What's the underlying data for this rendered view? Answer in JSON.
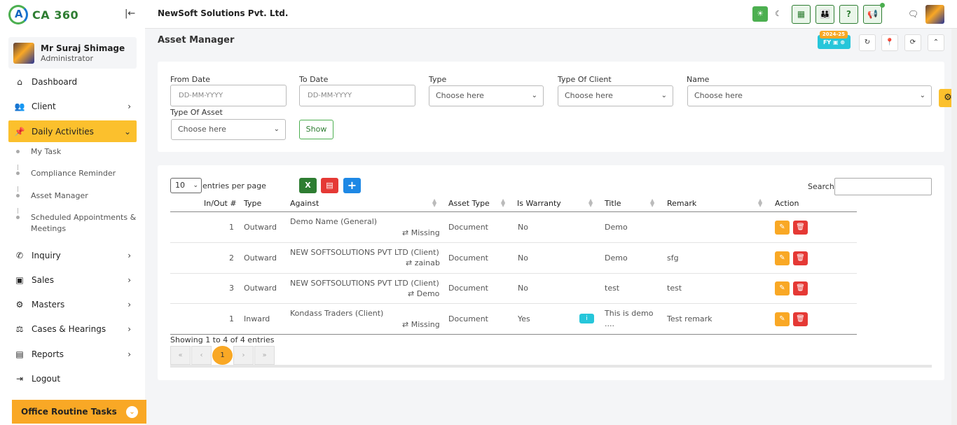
{
  "app": {
    "logo_text": "CA 360",
    "company": "NewSoft Solutions Pvt. Ltd."
  },
  "user": {
    "name": "Mr Suraj Shimage",
    "role": "Administrator"
  },
  "sidebar": {
    "items": [
      {
        "label": "Dashboard",
        "icon": "home-icon"
      },
      {
        "label": "Client",
        "icon": "users-icon"
      },
      {
        "label": "Daily Activities",
        "icon": "pin-icon"
      },
      {
        "label": "Inquiry",
        "icon": "phone-icon"
      },
      {
        "label": "Sales",
        "icon": "money-icon"
      },
      {
        "label": "Masters",
        "icon": "gears-icon"
      },
      {
        "label": "Cases & Hearings",
        "icon": "scale-icon"
      },
      {
        "label": "Reports",
        "icon": "file-icon"
      },
      {
        "label": "Logout",
        "icon": "logout-icon"
      }
    ],
    "sub_items": [
      "My Task",
      "Compliance Reminder",
      "Asset Manager",
      "Scheduled Appointments &",
      "Meetings"
    ],
    "office_tasks": "Office Routine Tasks"
  },
  "page": {
    "title": "Asset Manager",
    "fy_year": "2024-25",
    "fy_label": "FY"
  },
  "filters": {
    "from_date": {
      "label": "From Date",
      "placeholder": "DD-MM-YYYY"
    },
    "to_date": {
      "label": "To Date",
      "placeholder": "DD-MM-YYYY"
    },
    "type": {
      "label": "Type",
      "value": "Choose here"
    },
    "type_of_client": {
      "label": "Type Of Client",
      "value": "Choose here"
    },
    "name": {
      "label": "Name",
      "value": "Choose here"
    },
    "type_of_asset": {
      "label": "Type Of Asset",
      "value": "Choose here"
    },
    "show_label": "Show"
  },
  "table": {
    "entries_value": "10",
    "entries_text": "entries per page",
    "search_label": "Search:",
    "headers": [
      "In/Out #",
      "Type",
      "Against",
      "Asset Type",
      "Is Warranty",
      "Title",
      "Remark",
      "Action"
    ],
    "rows": [
      {
        "num": "1",
        "type": "Outward",
        "against": "Demo Name (General)",
        "sub": "Missing",
        "asset_type": "Document",
        "warranty": "No",
        "title": "Demo",
        "remark": ""
      },
      {
        "num": "2",
        "type": "Outward",
        "against": "NEW SOFTSOLUTIONS PVT LTD (Client)",
        "sub": "zainab",
        "asset_type": "Document",
        "warranty": "No",
        "title": "Demo",
        "remark": "sfg"
      },
      {
        "num": "3",
        "type": "Outward",
        "against": "NEW SOFTSOLUTIONS PVT LTD (Client)",
        "sub": "Demo",
        "asset_type": "Document",
        "warranty": "No",
        "title": "test",
        "remark": "test"
      },
      {
        "num": "1",
        "type": "Inward",
        "against": "Kondass Traders (Client)",
        "sub": "Missing",
        "asset_type": "Document",
        "warranty": "Yes",
        "title": "This is demo",
        "title2": "....",
        "remark": "Test remark"
      }
    ],
    "showing": "Showing 1 to 4 of 4 entries",
    "pager": [
      "«",
      "‹",
      "1",
      "›",
      "»"
    ]
  },
  "colors": {
    "accent": "#fbc02d",
    "green": "#2e7d32",
    "edit": "#f9a825",
    "delete": "#e53935",
    "info": "#26c6da"
  }
}
